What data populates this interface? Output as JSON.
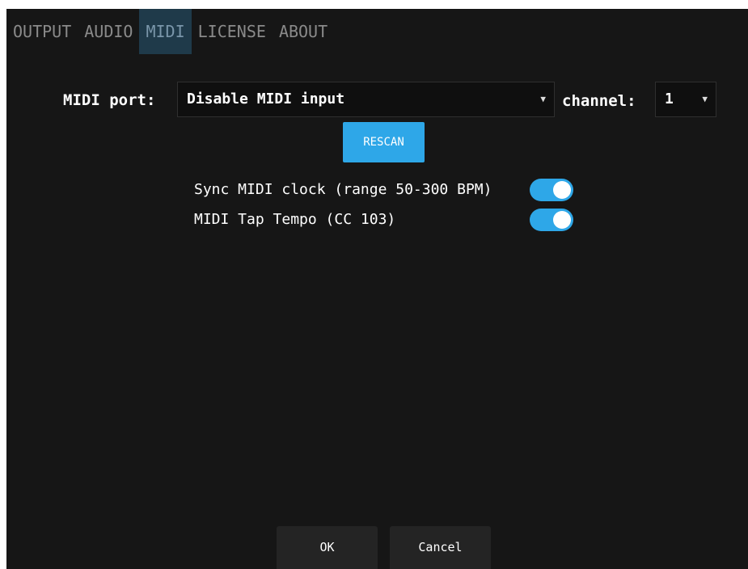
{
  "tabs": [
    {
      "label": "OUTPUT",
      "active": false
    },
    {
      "label": "AUDIO",
      "active": false
    },
    {
      "label": "MIDI",
      "active": true
    },
    {
      "label": "LICENSE",
      "active": false
    },
    {
      "label": "ABOUT",
      "active": false
    }
  ],
  "midi": {
    "port_label": "MIDI port:",
    "port_value": "Disable MIDI input",
    "channel_label": "channel:",
    "channel_value": "1",
    "rescan_label": "RESCAN"
  },
  "options": [
    {
      "label": "Sync MIDI clock (range 50-300 BPM)",
      "enabled": true
    },
    {
      "label": "MIDI Tap Tempo (CC 103)",
      "enabled": true
    }
  ],
  "footer": {
    "ok_label": "OK",
    "cancel_label": "Cancel"
  },
  "colors": {
    "accent": "#2ea7e8",
    "background": "#161616",
    "active_tab": "#1f3a4a"
  },
  "icons": {
    "dropdown": "caret-down-icon"
  }
}
